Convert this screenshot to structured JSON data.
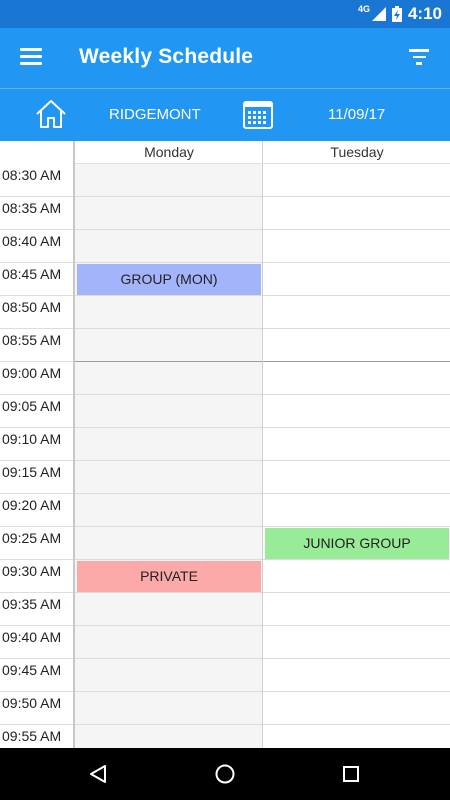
{
  "status_bar": {
    "network": "4G",
    "time": "4:10"
  },
  "app_bar": {
    "title": "Weekly Schedule",
    "menu_icon": "menu-icon",
    "filter_icon": "filter-icon"
  },
  "sub_bar": {
    "location": "RIDGEMONT",
    "date": "11/09/17",
    "home_icon": "home-icon",
    "calendar_icon": "calendar-icon"
  },
  "schedule": {
    "days": [
      "Monday",
      "Tuesday"
    ],
    "times": [
      "08:30 AM",
      "08:35 AM",
      "08:40 AM",
      "08:45 AM",
      "08:50 AM",
      "08:55 AM",
      "09:00 AM",
      "09:05 AM",
      "09:10 AM",
      "09:15 AM",
      "09:20 AM",
      "09:25 AM",
      "09:30 AM",
      "09:35 AM",
      "09:40 AM",
      "09:45 AM",
      "09:50 AM",
      "09:55 AM"
    ],
    "events": [
      {
        "label": "GROUP (MON)",
        "day": "Monday",
        "start": "08:45 AM",
        "color": "#A4B4FB"
      },
      {
        "label": "JUNIOR GROUP",
        "day": "Tuesday",
        "start": "09:25 AM",
        "color": "#98EC98"
      },
      {
        "label": "PRIVATE",
        "day": "Monday",
        "start": "09:30 AM",
        "color": "#FBA9A9"
      }
    ]
  },
  "colors": {
    "status_bar": "#1976D2",
    "app_bar": "#2196F3",
    "nav_bar": "#000000"
  },
  "nav_bar": {
    "back_icon": "back-icon",
    "home_icon": "home-circle-icon",
    "recents_icon": "recents-icon"
  }
}
